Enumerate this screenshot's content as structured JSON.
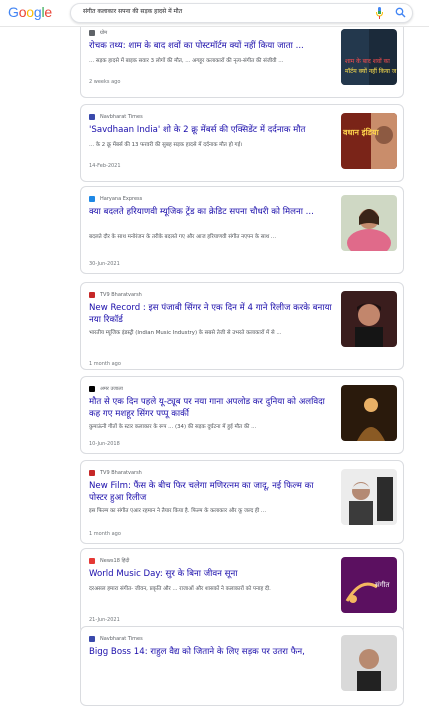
{
  "header": {
    "logo_letters": [
      "G",
      "o",
      "o",
      "g",
      "l",
      "e"
    ],
    "logo_colors": [
      "#4285F4",
      "#EA4335",
      "#FBBC05",
      "#4285F4",
      "#34A853",
      "#EA4335"
    ],
    "query": "संगीत कलाकार सपना की सड़क हादसे में मौत"
  },
  "results": [
    {
      "source": "ग्रोम",
      "favicon_color": "#5f6368",
      "title": "रोचक तथ्य: शाम के बाद शवों का पोस्टमॉर्टम क्यों नहीं किया जाता ...",
      "snippet": "... सड़क हादसे में बाइक सवार 3 लोगों की मौत, ... अगहूर कलाकारों की नृत्य-संगीत की संजीवी ...",
      "date": "2 weeks ago",
      "thumb_text": "शाम के बाद शवों का मॉर्टम क्यों नहीं किया ज"
    },
    {
      "source": "Navbharat Times",
      "favicon_color": "#3949ab",
      "title": "'Savdhaan India' शो के 2 क्रू मेंबर्स की एक्सिडेंट में दर्दनाक मौत",
      "snippet": "... के 2 क्रू मेंबर्स की 13 फरवरी की सुबह सड़क हादसे में दर्दनाक मौत हो गई।",
      "date": "14-Feb-2021",
      "thumb_text": "वधान इंडिया"
    },
    {
      "source": "Haryana Express",
      "favicon_color": "#1e88e5",
      "title": "क्या बदलते हरियाणवी म्यूजिक ट्रेंड का क्रेडिट सपना चौधरी को मिलना ...",
      "snippet": "बदलते दौर के साथ मनोरंजन के तरीके बदलते गए और आज हरियाणवी संगीत नएपन के साथ ...",
      "date": "30-Jun-2021",
      "thumb_text": ""
    },
    {
      "source": "TV9 Bharatvarsh",
      "favicon_color": "#c62828",
      "title": "New Record : इस पंजाबी सिंगर ने एक दिन में 4 गाने रिलीज करके बनाया नया रिकॉर्ड",
      "snippet": "भारतीय म्यूजिक इंडस्ट्री (Indian Music Industry) के सबसे तेजी से उभरते कलाकारों में से ...",
      "date": "1 month ago",
      "thumb_text": ""
    },
    {
      "source": "अमर उजाला",
      "favicon_color": "#000000",
      "title": "मौत से एक दिन पहले यू-ट्यूब पर नया गाना अपलोड कर दुनिया को अलविदा कह गए मशहूर सिंगर पप्पू कार्की",
      "snippet": "कुमाऊंनी गीतों के स्टार कलाकार के रूप ... (34) की सड़क दुर्घटना में हुई मौत की ...",
      "date": "10-Jun-2018",
      "thumb_text": ""
    },
    {
      "source": "TV9 Bharatvarsh",
      "favicon_color": "#c62828",
      "title": "New Film: फैंस के बीच फिर चलेगा मणिरत्नम का जादू, नई फिल्म का पोस्टर हुआ रिलीज",
      "snippet": "इस फिल्म का संगीत एआर रहमान ने तैयार किया है. फिल्म के कलाकार और कू जल्द ही ...",
      "date": "1 month ago",
      "thumb_text": ""
    },
    {
      "source": "News18 हिंदी",
      "favicon_color": "#e53935",
      "title": "World Music Day: सुर के बिना जीवन सूना",
      "snippet": "दरअसल हमारा संगीत- जीवन, प्रकृति और ... राजाओं और शासकों ने कलाकारों को पनाह दी.",
      "date": "21-Jun-2021",
      "thumb_text": "संगीत"
    },
    {
      "source": "Navbharat Times",
      "favicon_color": "#3949ab",
      "title": "Bigg Boss 14: राहुल वैद्य को जिताने के लिए सड़क पर उतरा फैन,",
      "snippet": "",
      "date": "",
      "thumb_text": ""
    }
  ]
}
